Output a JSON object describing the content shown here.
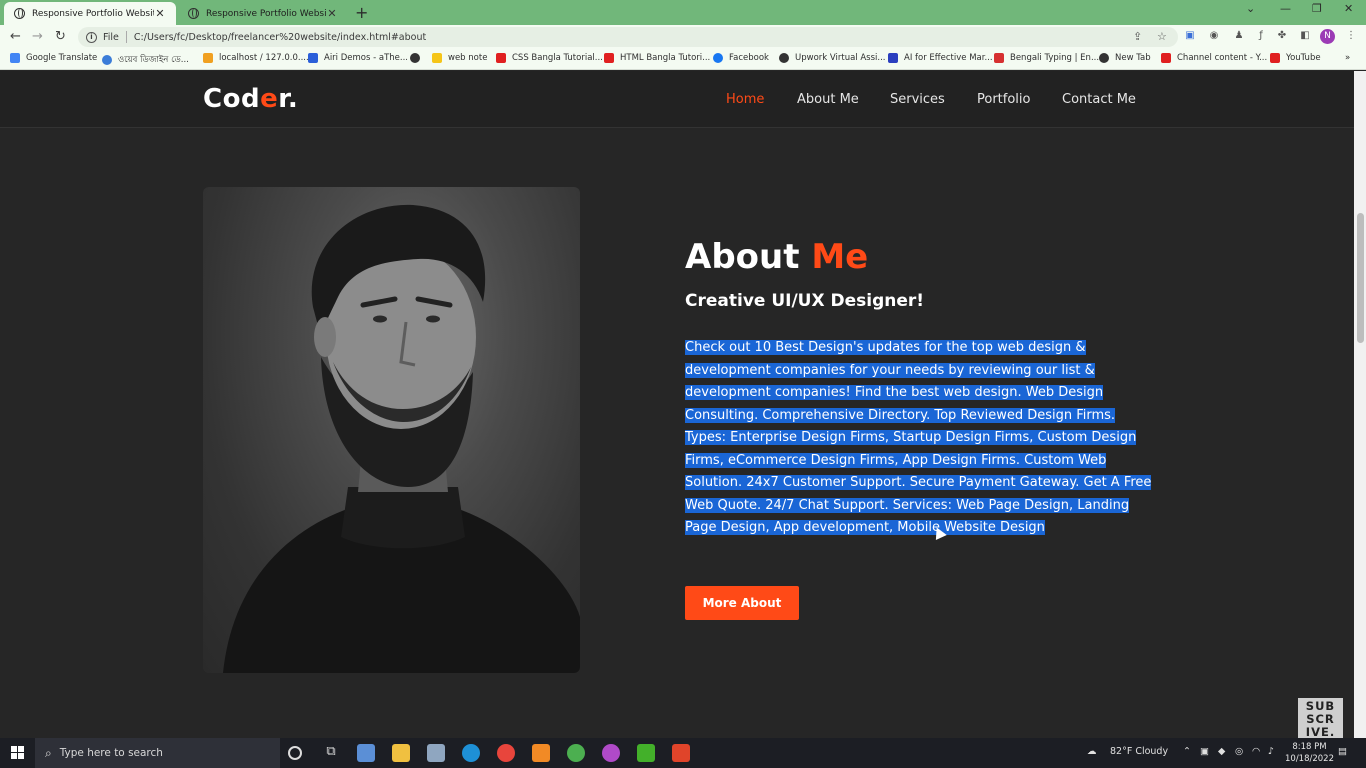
{
  "browser": {
    "tabs": [
      {
        "title": "Responsive Portfolio Website",
        "close": "✕"
      },
      {
        "title": "Responsive Portfolio Website",
        "close": "✕"
      }
    ],
    "new_tab": "+",
    "url_scheme": "File",
    "url": "C:/Users/fc/Desktop/freelancer%20website/index.html#about",
    "profile_initial": "N",
    "bookmarks": [
      "Google Translate",
      "ওয়েব ডিজাইন ডে...",
      "localhost / 127.0.0....",
      "Airi Demos - aThe...",
      "",
      "web note",
      "CSS Bangla Tutorial...",
      "HTML Bangla Tutori...",
      "Facebook",
      "Upwork Virtual Assi...",
      "AI for Effective Mar...",
      "Bengali Typing | En...",
      "New Tab",
      "Channel content - Y...",
      "YouTube"
    ],
    "bookmark_colors": [
      "#4285f4",
      "#3b7dd8",
      "#f0a020",
      "#2b5fd9",
      "#333333",
      "#f5c518",
      "#e02020",
      "#e02020",
      "#1877f2",
      "#333333",
      "#2b3fbf",
      "#d63030",
      "#333333",
      "#e02020",
      "#e02020"
    ]
  },
  "site": {
    "logo_main": "Cod",
    "logo_accent": "e",
    "logo_end": "r.",
    "nav": [
      "Home",
      "About Me",
      "Services",
      "Portfolio",
      "Contact Me"
    ],
    "active_nav": "Home",
    "accent_color": "#ff4a17",
    "about_title": "About",
    "about_title_accent": "Me",
    "about_subtitle": "Creative UI/UX Designer!",
    "about_text": "Check out 10 Best Design's updates for the top web design & development companies for your needs by reviewing our list & development companies! Find the best web design. Web Design Consulting. Comprehensive Directory. Top Reviewed Design Firms. Types: Enterprise Design Firms, Startup Design Firms, Custom Design Firms, eCommerce Design Firms, App Design Firms. Custom Web Solution. 24x7 Customer Support. Secure Payment Gateway. Get A Free Web Quote. 24/7 Chat Support. Services: Web Page Design, Landing Page Design, App development, Mobile Website Design",
    "button_label": "More About",
    "subscribe": "SUB SCR IVE."
  },
  "taskbar": {
    "search_placeholder": "Type here to search",
    "weather": "82°F  Cloudy",
    "time": "8:18 PM",
    "date": "10/18/2022"
  }
}
